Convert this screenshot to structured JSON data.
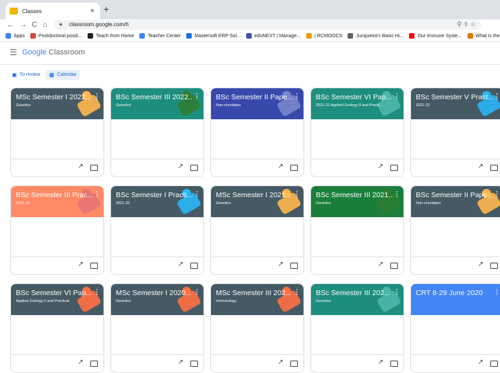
{
  "browser": {
    "tab_title": "Classes",
    "tab_close": "×",
    "new_tab": "+",
    "url": "classroom.google.com/h",
    "nav": {
      "back": "←",
      "forward": "→",
      "reload": "C",
      "home": "⌂"
    },
    "omni_icons": "⚲  ⇪  ☆"
  },
  "bookmarks": [
    {
      "label": "Apps",
      "color": "#4285f4"
    },
    {
      "label": "Postdoctoral positi...",
      "color": "#db4437"
    },
    {
      "label": "Teach from Home",
      "color": "#202124"
    },
    {
      "label": "Teacher Center",
      "color": "#4285f4"
    },
    {
      "label": "Mastersoft ERP Sol...",
      "color": "#1a73e8"
    },
    {
      "label": "eduNEXT | Manage...",
      "color": "#3f51b5"
    },
    {
      "label": "| RCMOOCS",
      "color": "#f29900"
    },
    {
      "label": "Junqueira's Basic Hi...",
      "color": "#5f6368"
    },
    {
      "label": "Our Immune Syste...",
      "color": "#ff0000"
    },
    {
      "label": "What is the com",
      "color": "#e37400"
    }
  ],
  "header": {
    "menu_icon": "☰",
    "logo_google": "Google",
    "logo_classroom": "Classroom"
  },
  "actions": [
    {
      "label": "To review",
      "icon": "▣"
    },
    {
      "label": "Calendar",
      "icon": "▦"
    }
  ],
  "cards": [
    {
      "title": "MSc Semester I 2022...",
      "subtitle": "Genetics",
      "color": "#455a64",
      "deco": "#ffb74d"
    },
    {
      "title": "BSc Semester III 2022...",
      "subtitle": "Genetics",
      "color": "#1e8e7e",
      "deco": "#2e7d32"
    },
    {
      "title": "BSc Semester II Pape...",
      "subtitle": "Non-chordates",
      "color": "#3949ab",
      "deco": "#7986cb"
    },
    {
      "title": "BSc Semester VI Pap...",
      "subtitle": "2021-22 Applied Zoology II and Practi...",
      "color": "#1e8e7e",
      "deco": "#4db6ac"
    },
    {
      "title": "BSc Semester V Pract...",
      "subtitle": "2021-22",
      "color": "#455a64",
      "deco": "#29b6f6"
    },
    {
      "title": "BSc Semester III Prac...",
      "subtitle": "2021-22",
      "color": "#ff8a65",
      "deco": "#e57373"
    },
    {
      "title": "BSc Semester I Practi...",
      "subtitle": "2021-22",
      "color": "#455a64",
      "deco": "#29b6f6"
    },
    {
      "title": "MSc Semester I 2021...",
      "subtitle": "Genetics",
      "color": "#455a64",
      "deco": "#ffb74d"
    },
    {
      "title": "BSc Semester III 2021...",
      "subtitle": "Genetics",
      "color": "#1b7f3b",
      "deco": "#2e7d32"
    },
    {
      "title": "BSc Semester II Pape...",
      "subtitle": "Non-chordates",
      "color": "#455a64",
      "deco": "#ffb74d"
    },
    {
      "title": "BSc Semester VI Pap...",
      "subtitle": "Applied Zoology II and Practical",
      "color": "#455a64",
      "deco": "#ff7043"
    },
    {
      "title": "MSc Semester I 2020...",
      "subtitle": "Genetics",
      "color": "#455a64",
      "deco": "#ff7043"
    },
    {
      "title": "MSc Semester III 202...",
      "subtitle": "Immunology",
      "color": "#455a64",
      "deco": "#ff7043"
    },
    {
      "title": "BSc Semester III 202...",
      "subtitle": "Genetics",
      "color": "#1e8e7e",
      "deco": "#4db6ac"
    },
    {
      "title": "CRT 8-29 June 2020",
      "subtitle": "",
      "color": "#4285f4",
      "deco": "#4285f4"
    }
  ],
  "card_icons": {
    "more": "⋮",
    "trend": "↗"
  }
}
